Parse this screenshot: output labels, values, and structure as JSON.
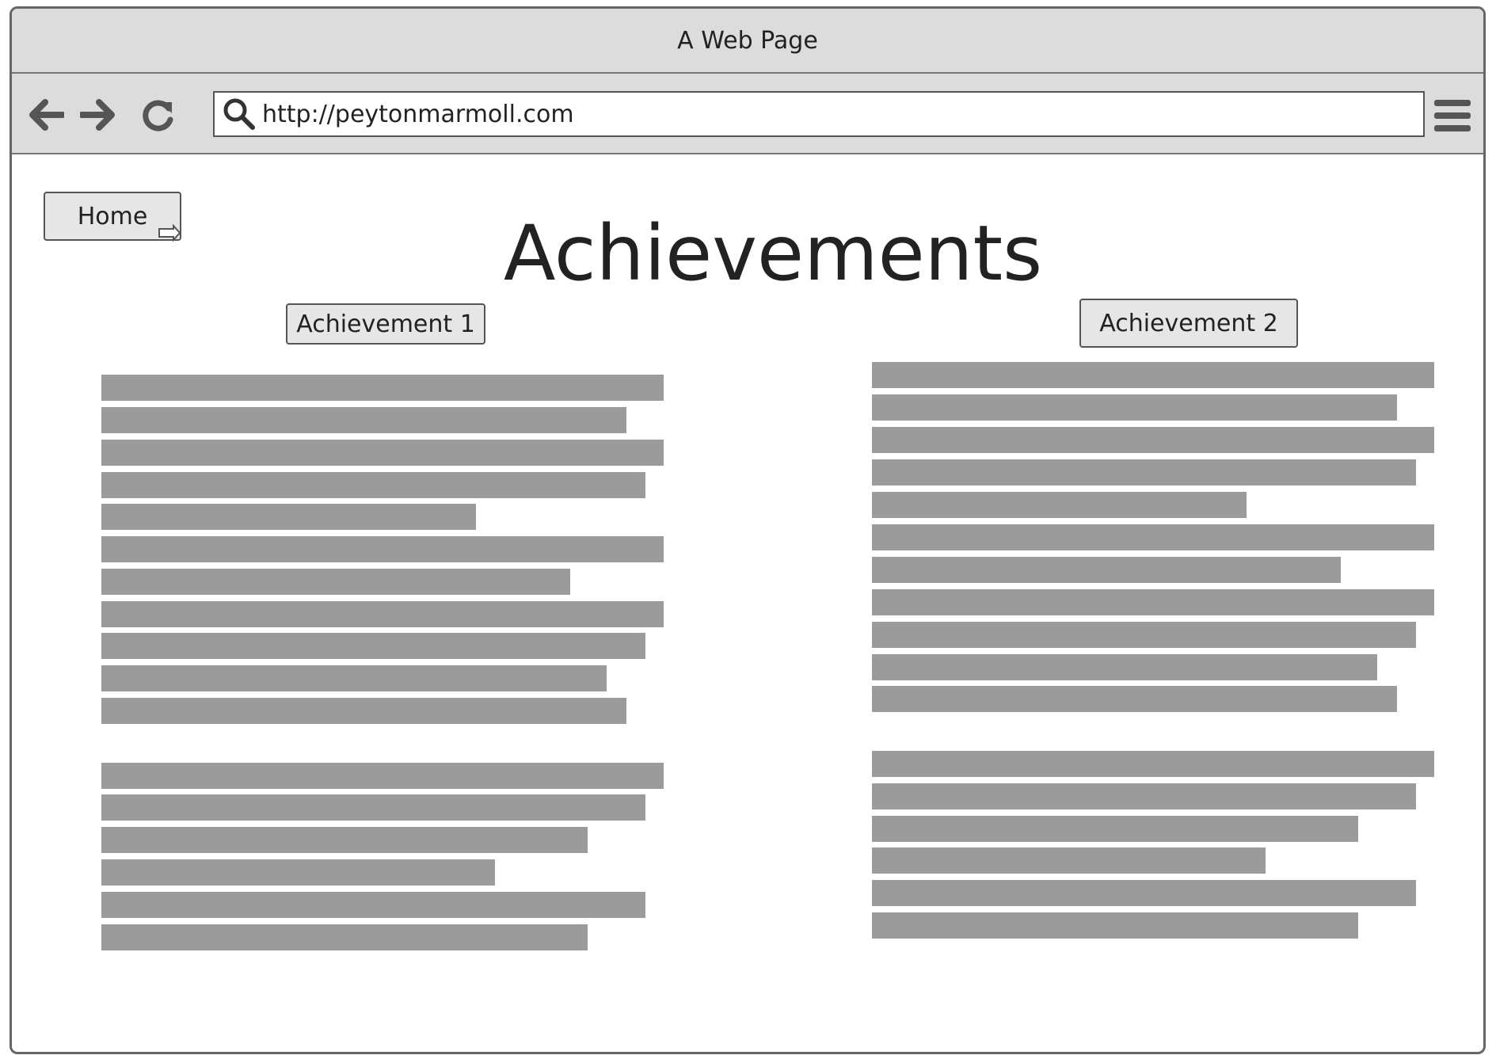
{
  "window": {
    "title": "A Web Page"
  },
  "toolbar": {
    "url": "http://peytonmarmoll.com",
    "icons": [
      "back-arrow-icon",
      "forward-arrow-icon",
      "reload-icon",
      "search-icon",
      "hamburger-menu-icon"
    ]
  },
  "page": {
    "home_label": "Home",
    "title": "Achievements",
    "achievement_1_label": "Achievement 1",
    "achievement_2_label": "Achievement 2"
  },
  "colors": {
    "chrome_bg": "#dcdcdc",
    "border": "#666666",
    "button_bg": "#e6e6e6",
    "text_placeholder": "#9b9b9b"
  }
}
